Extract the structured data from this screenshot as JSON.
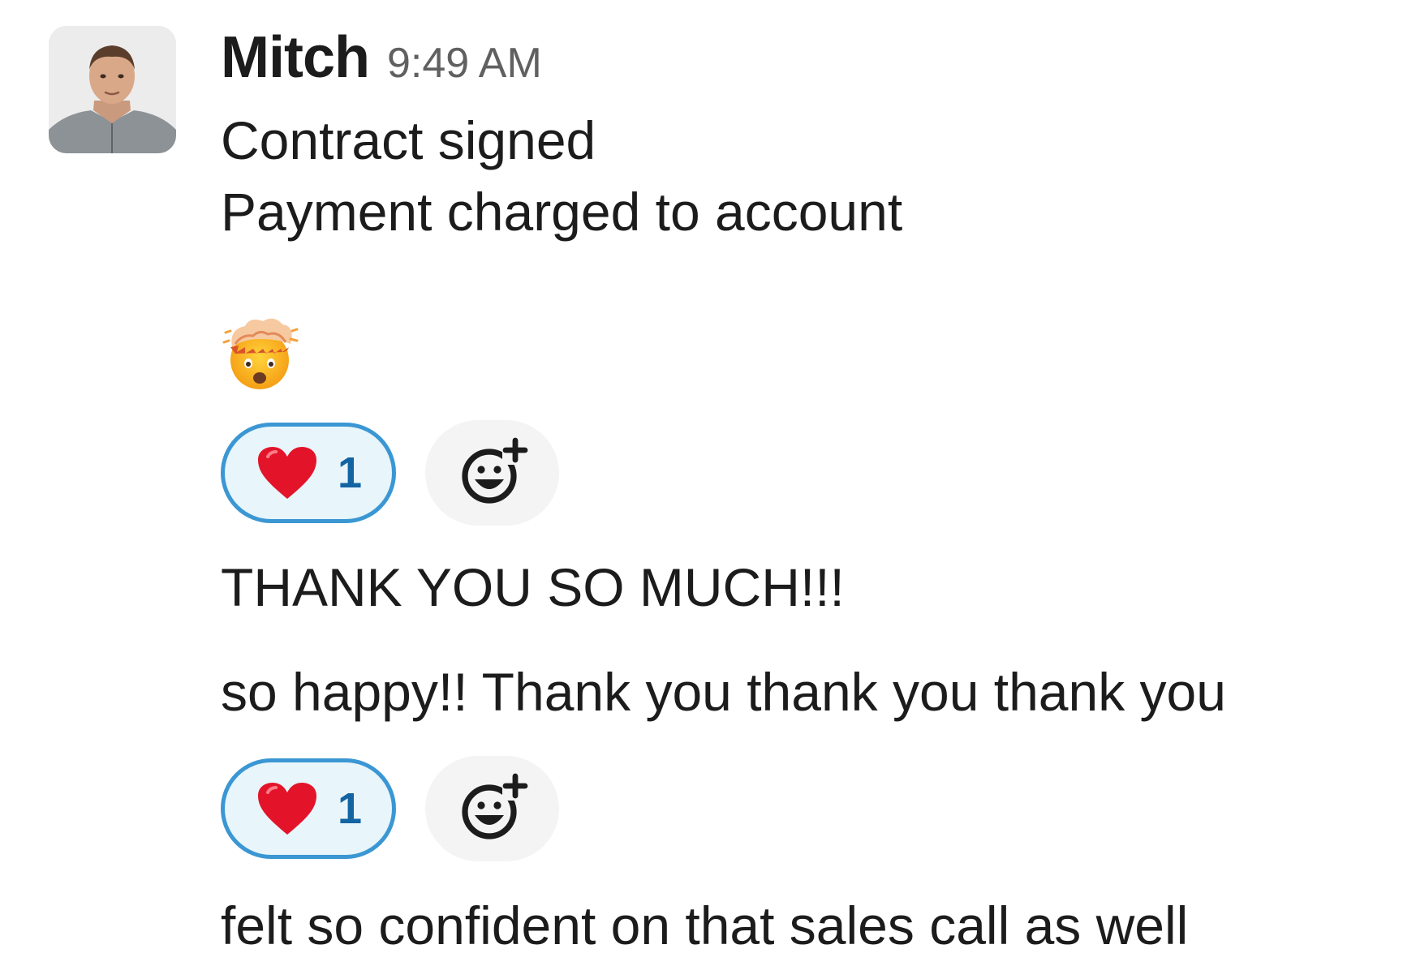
{
  "message": {
    "author": "Mitch",
    "time": "9:49 AM",
    "avatar_icon": "user-avatar-photo",
    "lines": [
      "Contract signed",
      "Payment charged to account"
    ],
    "emoji": "exploding-head-emoji"
  },
  "followups": [
    "THANK YOU SO MUCH!!!",
    "so happy!! Thank you thank you thank you",
    "felt so confident on that sales call as well"
  ],
  "reactions": [
    {
      "emoji": "heart-emoji",
      "count": "1",
      "add_icon": "add-reaction-icon"
    },
    {
      "emoji": "heart-emoji",
      "count": "1",
      "add_icon": "add-reaction-icon"
    }
  ],
  "colors": {
    "pill_border": "#3b97d3",
    "pill_bg": "#e8f5fa",
    "count": "#1264a3",
    "timestamp": "#616061"
  }
}
